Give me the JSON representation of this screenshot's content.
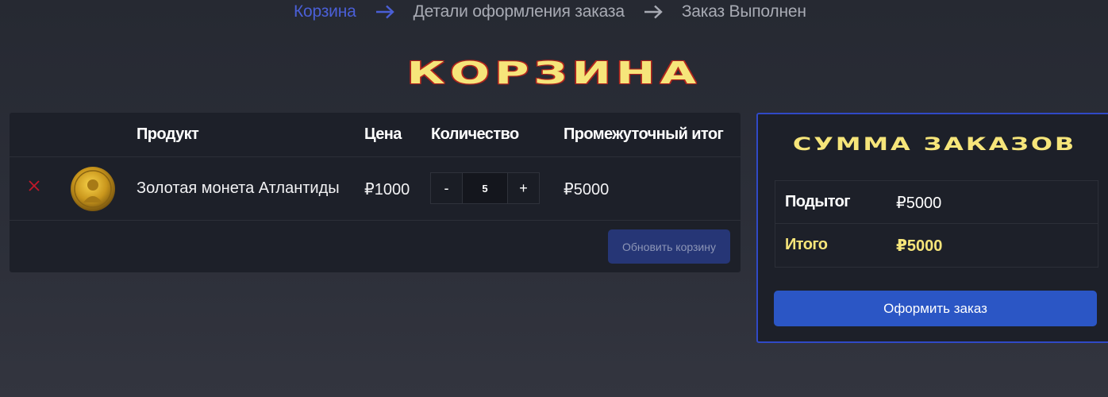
{
  "breadcrumbs": {
    "step1": "Корзина",
    "step2": "Детали оформления заказа",
    "step3": "Заказ Выполнен"
  },
  "page_title": "Корзина",
  "cart": {
    "headers": {
      "product": "Продукт",
      "price": "Цена",
      "quantity": "Количество",
      "subtotal": "Промежуточный итог"
    },
    "items": [
      {
        "name": "Золотая монета Атлантиды",
        "price": "₽1000",
        "quantity": "5",
        "subtotal": "₽5000",
        "minus_label": "-",
        "plus_label": "+"
      }
    ],
    "update_button": "Обновить корзину"
  },
  "totals": {
    "title": "Сумма заказов",
    "subtotal_label": "Подытог",
    "subtotal_value": "₽5000",
    "total_label": "Итого",
    "total_value": "₽5000",
    "checkout_button": "Оформить заказ"
  },
  "colors": {
    "accent": "#3049c6",
    "title_yellow": "#f6e57a",
    "remove_red": "#c0182a",
    "button_blue": "#2b56c5"
  },
  "icons": {
    "breadcrumb_arrow": "arrow-right-icon",
    "remove": "close-icon",
    "product_image": "gold-coin-image"
  }
}
